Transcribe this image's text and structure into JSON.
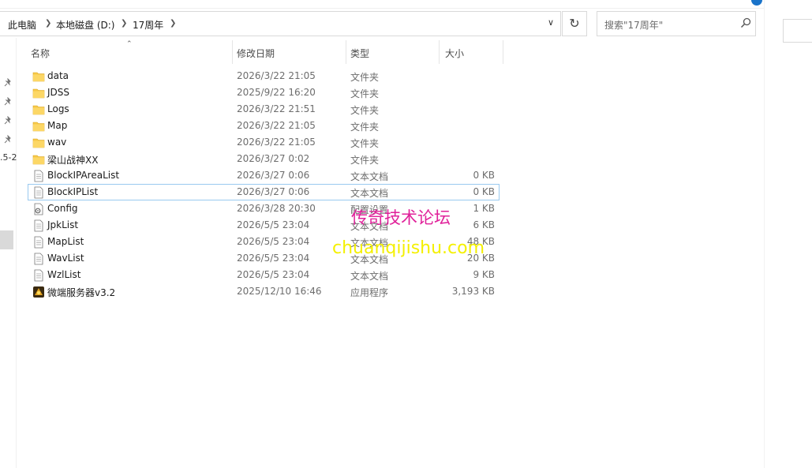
{
  "address": {
    "breadcrumbs": [
      "此电脑",
      "本地磁盘 (D:)",
      "17周年"
    ],
    "search_placeholder": "搜索\"17周年\""
  },
  "nav": {
    "clipped_text": ".5-2"
  },
  "columns": {
    "name": "名称",
    "date": "修改日期",
    "type": "类型",
    "size": "大小"
  },
  "files": [
    {
      "name": "data",
      "date": "2026/3/22 21:05",
      "type": "文件夹",
      "size": "",
      "icon": "folder-icon"
    },
    {
      "name": "JDSS",
      "date": "2025/9/22 16:20",
      "type": "文件夹",
      "size": "",
      "icon": "folder-icon"
    },
    {
      "name": "Logs",
      "date": "2026/3/22 21:51",
      "type": "文件夹",
      "size": "",
      "icon": "folder-icon"
    },
    {
      "name": "Map",
      "date": "2026/3/22 21:05",
      "type": "文件夹",
      "size": "",
      "icon": "folder-icon"
    },
    {
      "name": "wav",
      "date": "2026/3/22 21:05",
      "type": "文件夹",
      "size": "",
      "icon": "folder-icon"
    },
    {
      "name": "梁山战神XX",
      "date": "2026/3/27 0:02",
      "type": "文件夹",
      "size": "",
      "icon": "folder-icon"
    },
    {
      "name": "BlockIPAreaList",
      "date": "2026/3/27 0:06",
      "type": "文本文档",
      "size": "0 KB",
      "icon": "text-document-icon"
    },
    {
      "name": "BlockIPList",
      "date": "2026/3/27 0:06",
      "type": "文本文档",
      "size": "0 KB",
      "icon": "text-document-icon"
    },
    {
      "name": "Config",
      "date": "2026/3/28 20:30",
      "type": "配置设置",
      "size": "1 KB",
      "icon": "config-settings-icon"
    },
    {
      "name": "JpkList",
      "date": "2026/5/5 23:04",
      "type": "文本文档",
      "size": "6 KB",
      "icon": "text-document-icon"
    },
    {
      "name": "MapList",
      "date": "2026/5/5 23:04",
      "type": "文本文档",
      "size": "48 KB",
      "icon": "text-document-icon"
    },
    {
      "name": "WavList",
      "date": "2026/5/5 23:04",
      "type": "文本文档",
      "size": "20 KB",
      "icon": "text-document-icon"
    },
    {
      "name": "WzlList",
      "date": "2026/5/5 23:04",
      "type": "文本文档",
      "size": "9 KB",
      "icon": "text-document-icon"
    },
    {
      "name": "微端服务器v3.2",
      "date": "2025/12/10 16:46",
      "type": "应用程序",
      "size": "3,193 KB",
      "icon": "application-icon"
    }
  ],
  "watermark": {
    "cn": "传奇技术论坛",
    "en": "chuanqijishu.com"
  },
  "colors": {
    "folder": "#f7c948",
    "focus_border": "#99c9ef",
    "watermark_cn": "#e0219a",
    "watermark_en": "#f4f000"
  }
}
